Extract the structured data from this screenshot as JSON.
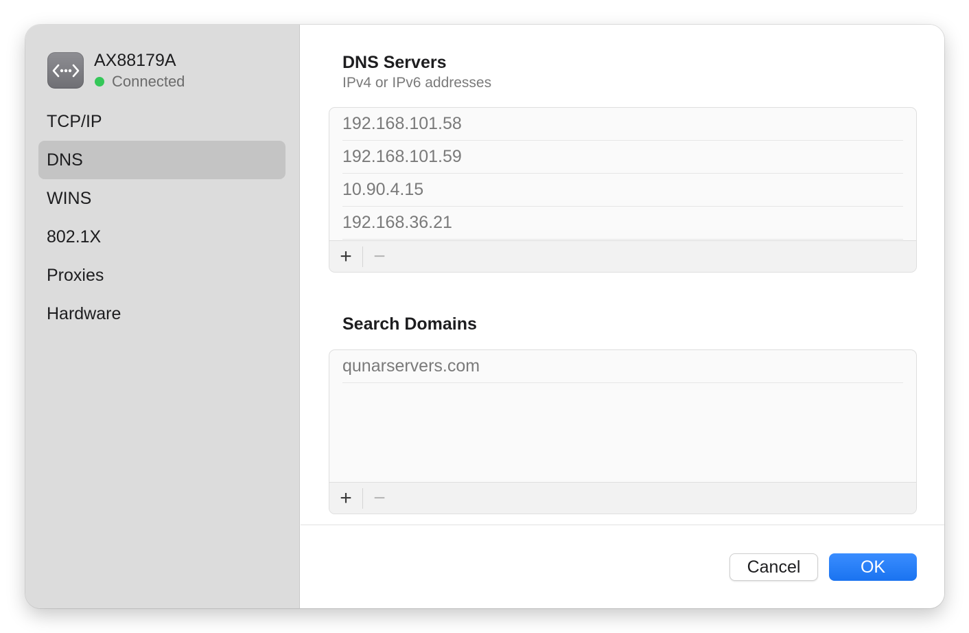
{
  "sidebar": {
    "interface_name": "AX88179A",
    "status_text": "Connected",
    "status_color": "#35c759",
    "interface_icon": "ethernet-icon",
    "items": [
      {
        "label": "TCP/IP",
        "selected": false
      },
      {
        "label": "DNS",
        "selected": true
      },
      {
        "label": "WINS",
        "selected": false
      },
      {
        "label": "802.1X",
        "selected": false
      },
      {
        "label": "Proxies",
        "selected": false
      },
      {
        "label": "Hardware",
        "selected": false
      }
    ]
  },
  "dns": {
    "title": "DNS Servers",
    "subtitle": "IPv4 or IPv6 addresses",
    "servers": [
      "192.168.101.58",
      "192.168.101.59",
      "10.90.4.15",
      "192.168.36.21"
    ],
    "add_label": "+",
    "remove_label": "−"
  },
  "search": {
    "title": "Search Domains",
    "domains": [
      "qunarservers.com"
    ],
    "add_label": "+",
    "remove_label": "−"
  },
  "footer": {
    "cancel_label": "Cancel",
    "ok_label": "OK",
    "accent_color": "#1a73f0"
  }
}
